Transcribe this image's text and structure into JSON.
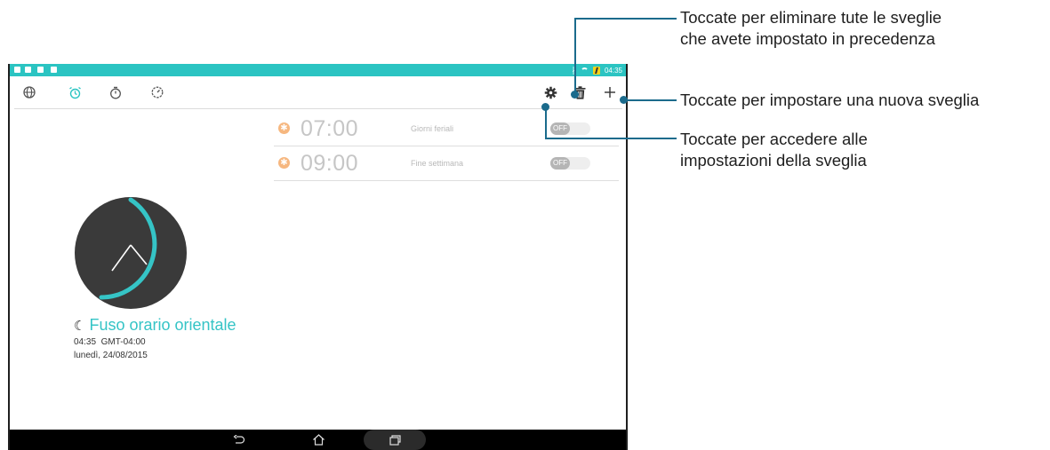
{
  "status_bar": {
    "time": "04:35",
    "icons": [
      "notification-icon",
      "notification-icon",
      "notification-icon",
      "notification-icon",
      "bluetooth-icon",
      "wifi-icon",
      "battery-charging-icon"
    ]
  },
  "toolbar": {
    "tabs": [
      {
        "name": "world-clock",
        "icon": "globe-icon"
      },
      {
        "name": "alarm",
        "icon": "alarm-clock-icon",
        "active": true
      },
      {
        "name": "stopwatch",
        "icon": "stopwatch-icon"
      },
      {
        "name": "timer",
        "icon": "timer-icon"
      }
    ],
    "actions": [
      "settings-gear-icon",
      "trash-icon",
      "plus-icon"
    ]
  },
  "alarms": [
    {
      "time": "07:00",
      "label": "Giorni feriali",
      "toggle": "OFF"
    },
    {
      "time": "09:00",
      "label": "Fine settimana",
      "toggle": "OFF"
    }
  ],
  "timezone": {
    "name": "Fuso orario orientale",
    "time": "04:35",
    "offset": "GMT-04:00",
    "date": "lunedì, 24/08/2015"
  },
  "callouts": {
    "delete": [
      "Toccate per eliminare tute le sveglie",
      "che avete impostato in precedenza"
    ],
    "add": "Toccate per impostare una nuova sveglia",
    "settings": [
      "Toccate per accedere alle",
      "impostazioni della sveglia"
    ]
  },
  "colors": {
    "accent": "#2bc4c2",
    "callout": "#1b6b8c",
    "alarm_icon": "#f6b77f"
  }
}
